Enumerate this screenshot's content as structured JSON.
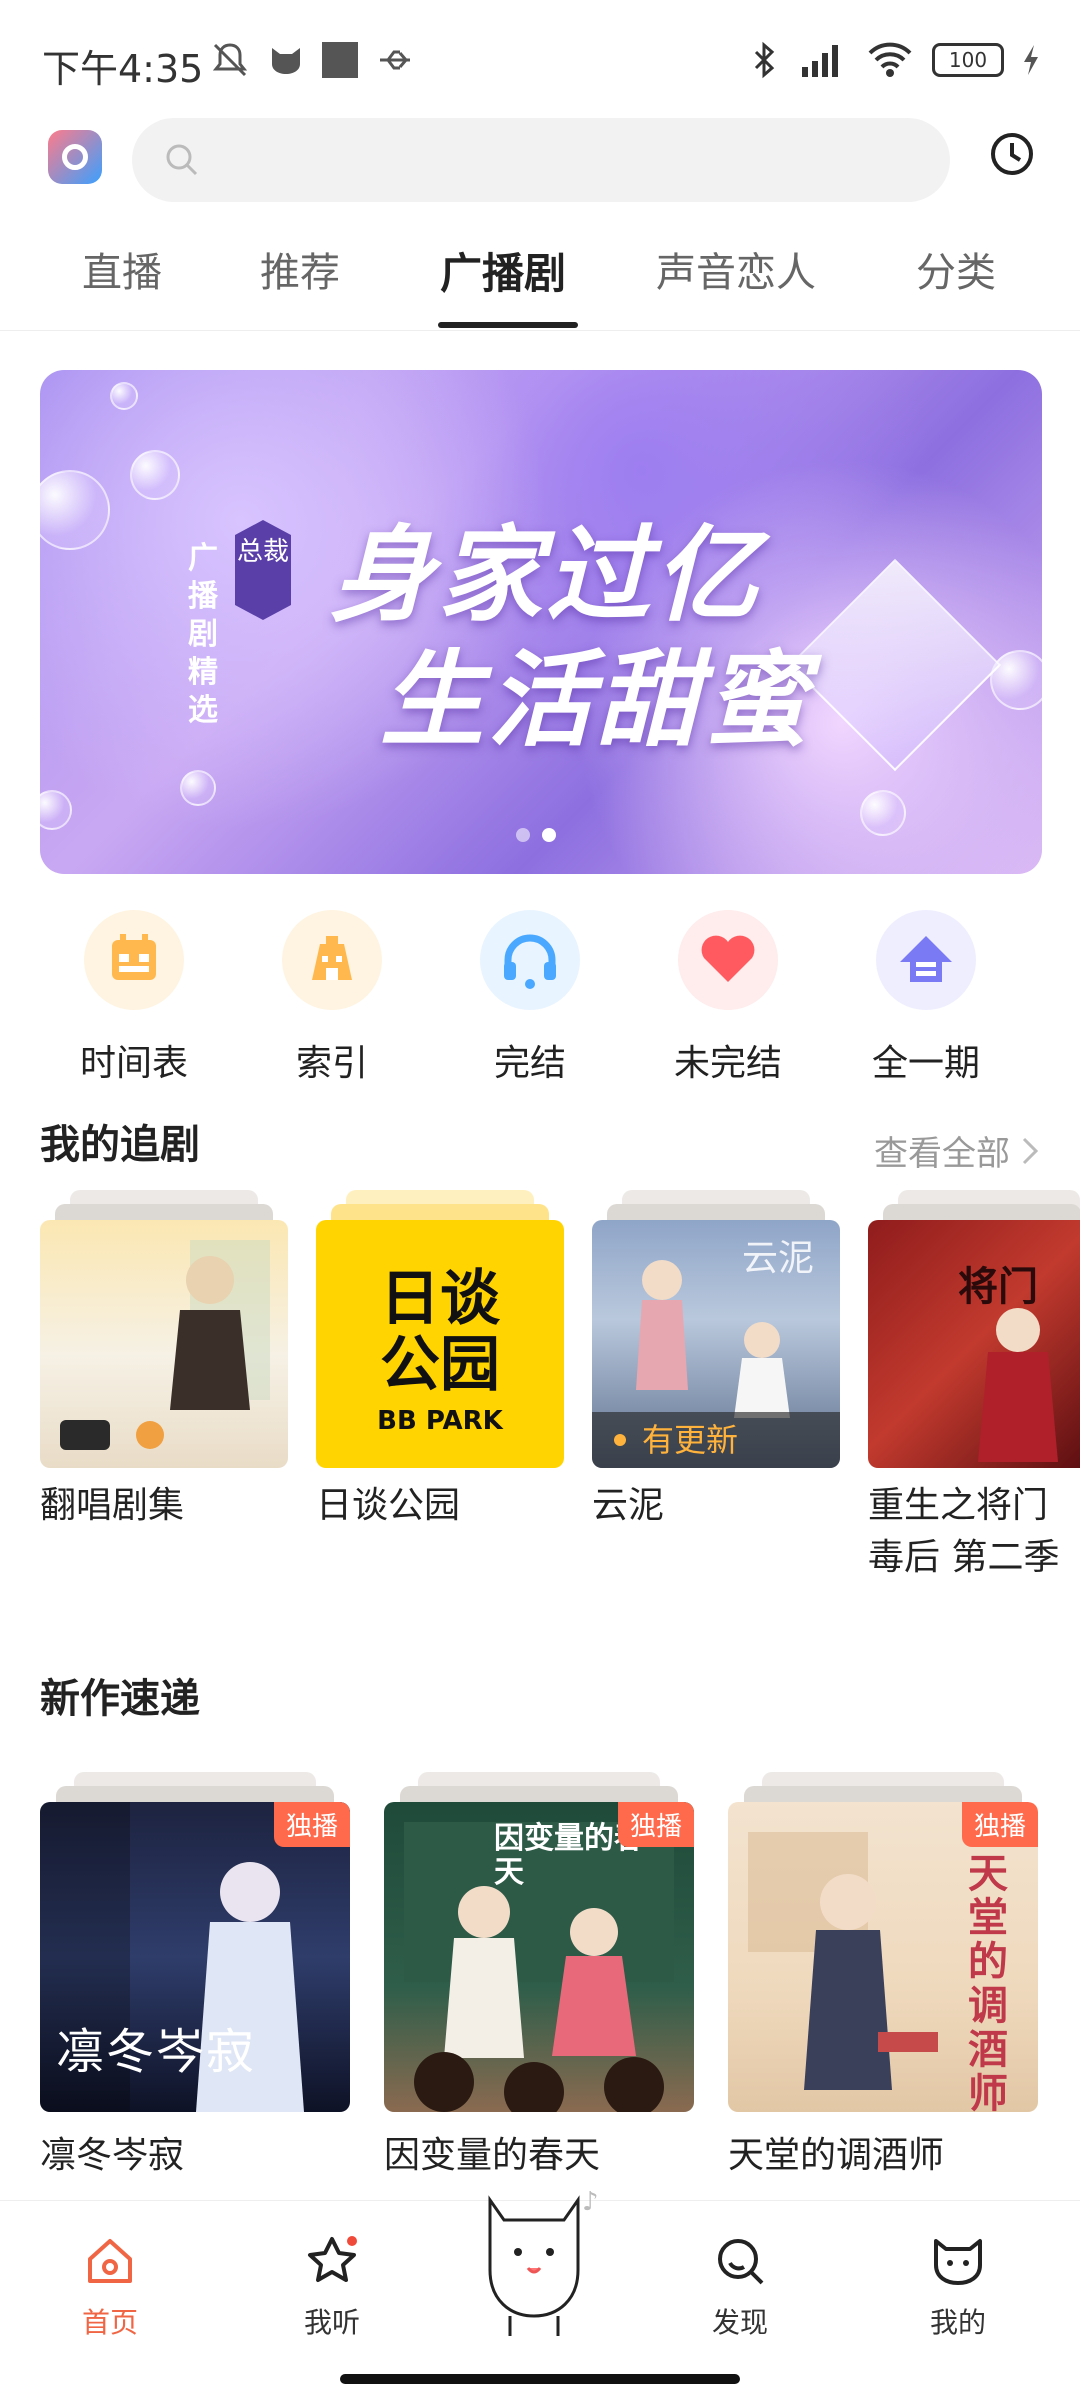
{
  "status_bar": {
    "time": "下午4:35",
    "battery": "100"
  },
  "search": {
    "placeholder": ""
  },
  "tabs": [
    {
      "label": "直播"
    },
    {
      "label": "推荐"
    },
    {
      "label": "广播剧"
    },
    {
      "label": "声音恋人"
    },
    {
      "label": "分类"
    }
  ],
  "banner": {
    "side_text": "广播剧精选",
    "badge": "总裁",
    "title_line1": "身家过亿",
    "title_line2": "生活甜蜜"
  },
  "quick_entries": [
    {
      "label": "时间表",
      "icon": "calendar-icon",
      "color": "#ffb84d"
    },
    {
      "label": "索引",
      "icon": "index-icon",
      "color": "#ffb84d"
    },
    {
      "label": "完结",
      "icon": "headphones-icon",
      "color": "#4aa8ff"
    },
    {
      "label": "未完结",
      "icon": "heart-icon",
      "color": "#ff5a5f"
    },
    {
      "label": "全一期",
      "icon": "full-icon",
      "color": "#7a7af5"
    }
  ],
  "follow_section": {
    "title": "我的追剧",
    "view_all": "查看全部",
    "items": [
      {
        "title": "翻唱剧集"
      },
      {
        "title": "日谈公园",
        "cover_text1": "日谈",
        "cover_text2": "公园",
        "cover_text3": "BB PARK"
      },
      {
        "title": "云泥",
        "tag": "有更新"
      },
      {
        "title": "重生之将门毒后 第二季"
      }
    ]
  },
  "new_section": {
    "title": "新作速递",
    "items": [
      {
        "title": "凛冬岑寂",
        "badge": "独播",
        "cover_text": "凛冬岑寂"
      },
      {
        "title": "因变量的春天",
        "badge": "独播",
        "cover_text": "因变量的春天"
      },
      {
        "title": "天堂的调酒师",
        "badge": "独播",
        "cover_text": "天堂的调酒师"
      }
    ]
  },
  "bottom_nav": [
    {
      "label": "首页",
      "icon": "home-icon",
      "active": true
    },
    {
      "label": "我听",
      "icon": "star-icon",
      "active": false
    },
    {
      "label": "发现",
      "icon": "discover-icon",
      "active": false
    },
    {
      "label": "我的",
      "icon": "cat-face-icon",
      "active": false
    }
  ],
  "colors": {
    "accent": "#f06644",
    "exclusive_badge": "#ff6a4c",
    "update_tag": "#ffb23c"
  }
}
